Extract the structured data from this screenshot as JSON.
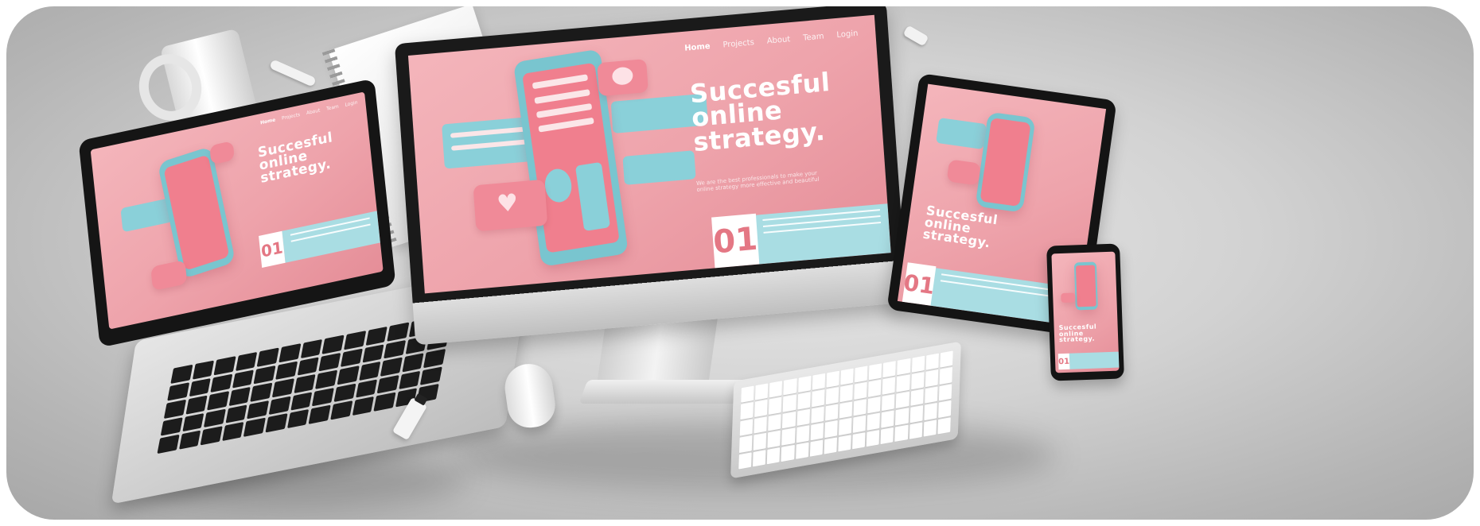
{
  "scene": {
    "description_tag": "Floating devices mockup",
    "colors": {
      "pink": "#f0a3ab",
      "pink_dark": "#e47784",
      "teal": "#8ad0d9",
      "background": "#cfcfcf"
    }
  },
  "monitor": {
    "nav": [
      "Home",
      "Projects",
      "About",
      "Team",
      "Login"
    ],
    "headline": "Succesful\nonline\nstrategy.",
    "subline": "We are the best professionals to make your online strategy more effective and beautiful",
    "number": "01"
  },
  "laptop": {
    "nav": [
      "Home",
      "Projects",
      "About",
      "Team",
      "Login"
    ],
    "headline": "Succesful\nonline\nstrategy.",
    "number": "01"
  },
  "tablet": {
    "headline": "Succesful\nonline\nstrategy.",
    "number": "01"
  },
  "smartphone": {
    "headline": "Succesful\nonline\nstrategy.",
    "number": "01"
  }
}
